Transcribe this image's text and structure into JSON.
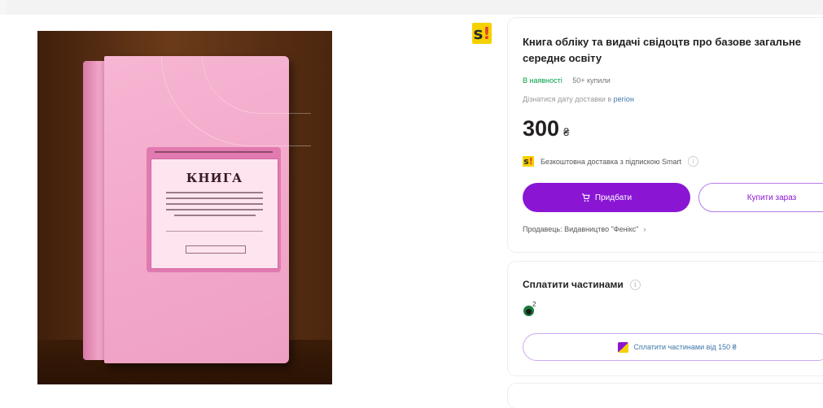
{
  "product": {
    "title": "Книга обліку та видачі свідоцтв про базове загальне середнє освіту",
    "availability": "В наявності",
    "purchases": "50+ купили",
    "delivery_text": "Дізнатися дату доставки в",
    "delivery_link": "регіон",
    "price": "300",
    "currency": "₴",
    "free_delivery": "Безкоштовна доставка з підпискою Smart",
    "seller": "Продавець: Видавництво \"Фенікс\""
  },
  "buttons": {
    "buy": "Придбати",
    "buy_now": "Купити зараз",
    "installments": "Сплатити частинами від 150 ₴"
  },
  "installments": {
    "title": "Сплатити частинами",
    "bank_count": "2"
  },
  "badges": {
    "smart_letter": "s",
    "smart_mark": "!"
  },
  "cover": {
    "title": "КНИГА"
  },
  "colors": {
    "accent": "#8a16d4",
    "available": "#00a046",
    "smart": "#f5d100"
  }
}
